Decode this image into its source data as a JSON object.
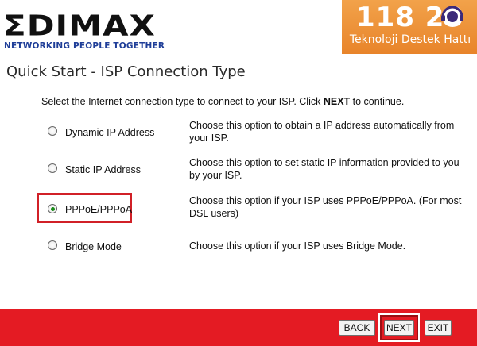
{
  "header": {
    "logo_text": "ΣDIMAX",
    "logo_tagline": "NETWORKING PEOPLE TOGETHER",
    "badge_number": "118 20",
    "badge_text": "Teknoloji Destek Hattı"
  },
  "page": {
    "title": "Quick Start - ISP Connection Type",
    "instruction_before": "Select the Internet connection type to connect to your ISP. Click ",
    "instruction_bold": "NEXT",
    "instruction_after": " to continue."
  },
  "options": [
    {
      "label": "Dynamic IP Address",
      "description": "Choose this option to obtain a IP address automatically from your ISP.",
      "selected": false
    },
    {
      "label": "Static IP Address",
      "description": "Choose this option to set static IP information provided to you by your ISP.",
      "selected": false
    },
    {
      "label": "PPPoE/PPPoA",
      "description": "Choose this option if your ISP uses PPPoE/PPPoA. (For most DSL users)",
      "selected": true
    },
    {
      "label": "Bridge Mode",
      "description": "Choose this option if your ISP uses Bridge Mode.",
      "selected": false
    }
  ],
  "footer": {
    "back_label": "BACK",
    "next_label": "NEXT",
    "exit_label": "EXIT"
  },
  "colors": {
    "footer_red": "#e41b23",
    "badge_orange": "#e8842a",
    "highlight_red": "#d12027",
    "tagline_blue": "#1f3e98"
  }
}
